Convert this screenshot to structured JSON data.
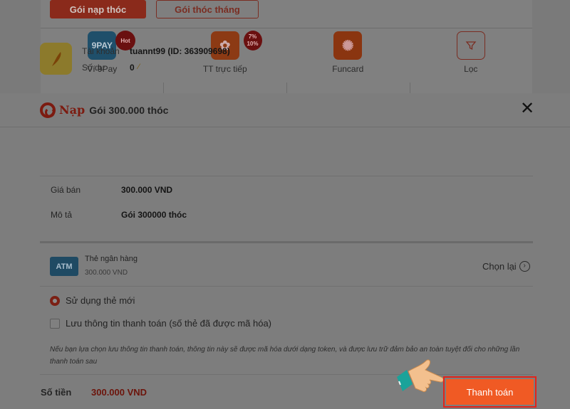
{
  "background": {
    "tabs": [
      {
        "label": "Gói nạp thóc",
        "active": true
      },
      {
        "label": "Gói thóc tháng",
        "active": false
      }
    ],
    "methods": [
      {
        "label": "Ví 9Pay",
        "icon": "9pay-icon",
        "icon_text": "9PAY",
        "badge": "Hot"
      },
      {
        "label": "TT trực tiếp",
        "icon": "leaf-icon",
        "badge_top": "7%",
        "badge_bottom": "10%"
      },
      {
        "label": "Funcard",
        "icon": "funcard-swirl-icon"
      },
      {
        "label": "Lọc",
        "icon": "filter-icon"
      }
    ]
  },
  "modal": {
    "logo_text": "Nạp",
    "title": "Gói 300.000 thóc",
    "account": {
      "account_label": "Tài khoản",
      "account_value": "tuannt99 (ID: 363909698)",
      "balance_label": "Số dư",
      "balance_value": "0"
    },
    "info": {
      "price_label": "Giá bán",
      "price_value": "300.000 VND",
      "desc_label": "Mô tả",
      "desc_value": "Gói 300000 thóc"
    },
    "payment": {
      "badge": "ATM",
      "name": "Thẻ ngân hàng",
      "amount": "300.000 VND",
      "choose_again": "Chọn lại"
    },
    "options": {
      "use_new_card": "Sử dụng thẻ mới",
      "save_info": "Lưu thông tin thanh toán (số thẻ đã được mã hóa)",
      "note": "Nếu bạn lựa chọn lưu thông tin thanh toán, thông tin này sẽ được mã hóa dưới dạng token, và được lưu trữ đảm bảo an toàn tuyệt đối cho những lần thanh toán sau"
    },
    "total": {
      "label": "Số tiền",
      "value": "300.000 VND"
    },
    "pay_button": "Thanh toán"
  },
  "colors": {
    "accent": "#f05a24",
    "highlight_border": "#e3231a",
    "overlay": "#7d7d7d"
  }
}
